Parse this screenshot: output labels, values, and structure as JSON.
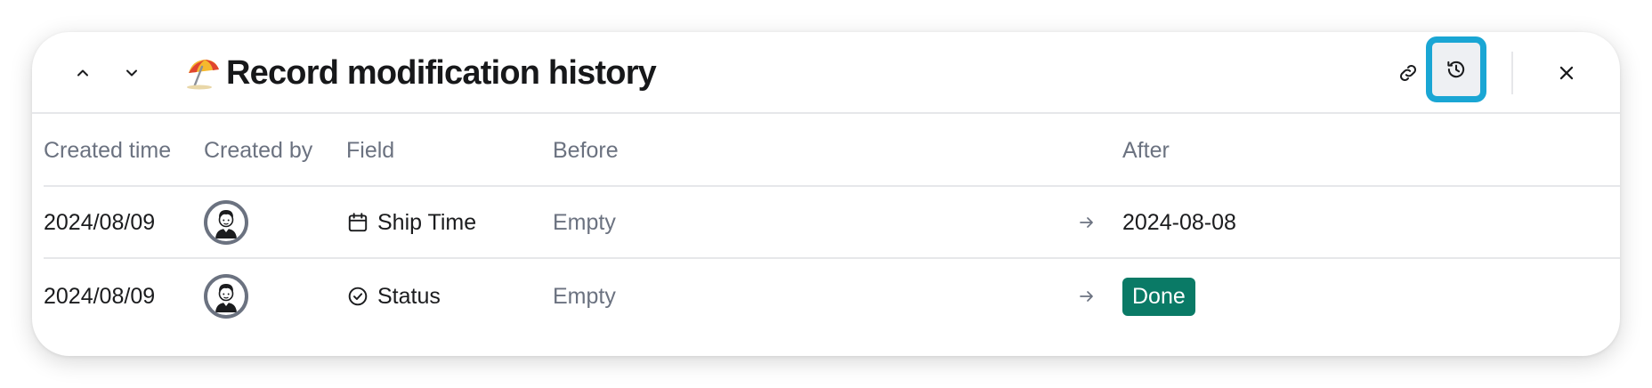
{
  "panel": {
    "title": "Record modification history",
    "title_emoji": "beach-umbrella",
    "nav": {
      "up_icon": "chevron-up-icon",
      "down_icon": "chevron-down-icon"
    },
    "actions": {
      "link_icon": "link-icon",
      "history_icon": "history-icon",
      "close_icon": "close-icon"
    },
    "accent_color": "#1aa6d4"
  },
  "table": {
    "columns": [
      "Created time",
      "Created by",
      "Field",
      "Before",
      "After"
    ],
    "rows": [
      {
        "created_time": "2024/08/09",
        "created_by": "user-avatar",
        "field": "Ship Time",
        "field_icon": "calendar-icon",
        "before": "Empty",
        "after": "2024-08-08"
      },
      {
        "created_time": "2024/08/09",
        "created_by": "user-avatar",
        "field": "Status",
        "field_icon": "check-circle-icon",
        "before": "Empty",
        "after": "Done",
        "after_color": "#0a7a66"
      }
    ]
  }
}
